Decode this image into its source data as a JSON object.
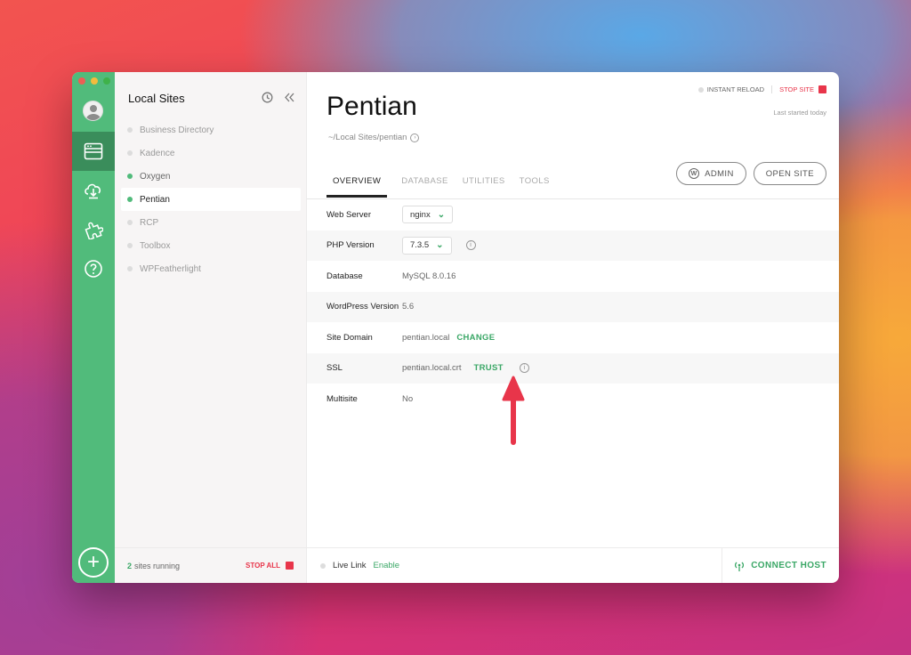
{
  "colors": {
    "accent": "#51bb7b",
    "accent_dark": "#3a8d5b",
    "stop": "#e8354a",
    "arrow": "#e8354a"
  },
  "sidebar": {
    "title": "Local Sites",
    "sites": [
      {
        "name": "Business Directory",
        "running": false,
        "active": false
      },
      {
        "name": "Kadence",
        "running": false,
        "active": false
      },
      {
        "name": "Oxygen",
        "running": true,
        "active": false
      },
      {
        "name": "Pentian",
        "running": true,
        "active": true
      },
      {
        "name": "RCP",
        "running": false,
        "active": false
      },
      {
        "name": "Toolbox",
        "running": false,
        "active": false
      },
      {
        "name": "WPFeatherlight",
        "running": false,
        "active": false
      }
    ],
    "footer": {
      "running_count": "2",
      "running_label": "sites running",
      "stop_all": "STOP ALL"
    }
  },
  "site": {
    "name": "Pentian",
    "path": "~/Local Sites/pentian",
    "instant_reload": "INSTANT RELOAD",
    "stop_site": "STOP SITE",
    "last_started": "Last started today"
  },
  "tabs": [
    "OVERVIEW",
    "DATABASE",
    "UTILITIES",
    "TOOLS"
  ],
  "buttons": {
    "admin": "ADMIN",
    "open_site": "OPEN SITE"
  },
  "overview": {
    "web_server": {
      "label": "Web Server",
      "value": "nginx"
    },
    "php": {
      "label": "PHP Version",
      "value": "7.3.5"
    },
    "database": {
      "label": "Database",
      "value": "MySQL 8.0.16"
    },
    "wordpress": {
      "label": "WordPress Version",
      "value": "5.6"
    },
    "domain": {
      "label": "Site Domain",
      "value": "pentian.local",
      "action": "CHANGE"
    },
    "ssl": {
      "label": "SSL",
      "value": "pentian.local.crt",
      "action": "TRUST"
    },
    "multisite": {
      "label": "Multisite",
      "value": "No"
    }
  },
  "footer": {
    "live_link": "Live Link",
    "enable": "Enable",
    "connect_host": "CONNECT HOST"
  }
}
